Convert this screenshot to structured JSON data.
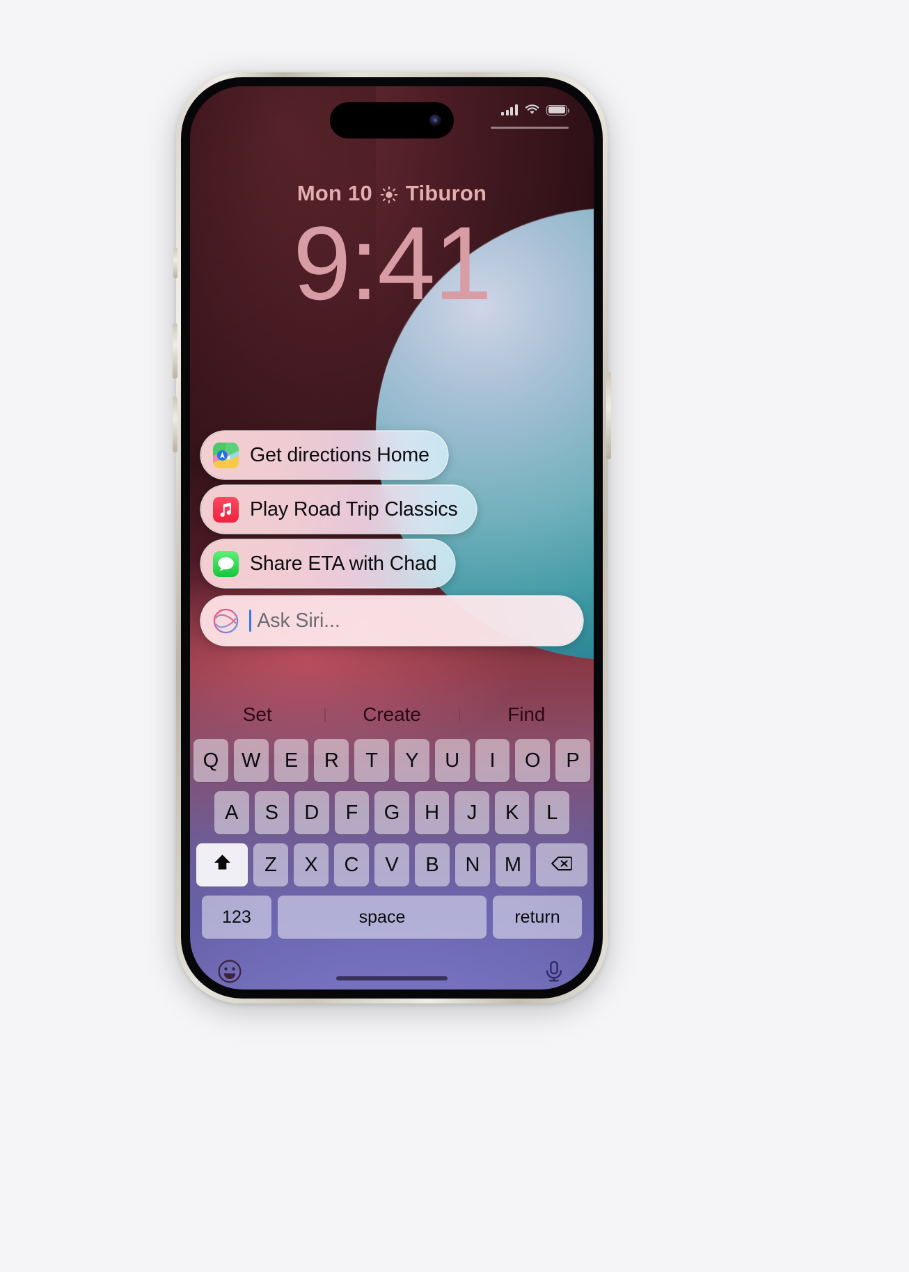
{
  "device": {
    "model": "iPhone",
    "frame_color": "#e8e4db"
  },
  "status_bar": {
    "signal_icon": "cellular-signal-icon",
    "signal_bars": 4,
    "wifi_icon": "wifi-icon",
    "battery_icon": "battery-icon",
    "battery_level": 100
  },
  "lock_screen": {
    "date": "Mon 10",
    "weather_icon": "sun-icon",
    "location": "Tiburon",
    "time": "9:41",
    "time_color": "#d79ca4",
    "date_color": "#e2aeb0"
  },
  "siri": {
    "orb_icon": "siri-orb-icon",
    "input_placeholder": "Ask Siri...",
    "input_value": "",
    "caret_color": "#2f7bf6",
    "suggestions": [
      {
        "label": "Get directions Home",
        "app": "maps",
        "icon": "maps-app-icon"
      },
      {
        "label": "Play Road Trip Classics",
        "app": "music",
        "icon": "music-app-icon"
      },
      {
        "label": "Share ETA with Chad",
        "app": "messages",
        "icon": "messages-app-icon"
      }
    ]
  },
  "predictive_bar": {
    "items": [
      "Set",
      "Create",
      "Find"
    ]
  },
  "keyboard": {
    "row1": [
      "Q",
      "W",
      "E",
      "R",
      "T",
      "Y",
      "U",
      "I",
      "O",
      "P"
    ],
    "row2": [
      "A",
      "S",
      "D",
      "F",
      "G",
      "H",
      "J",
      "K",
      "L"
    ],
    "row3": [
      "Z",
      "X",
      "C",
      "V",
      "B",
      "N",
      "M"
    ],
    "shift_icon": "shift-arrow-icon",
    "shift_active": true,
    "delete_icon": "delete-backspace-icon",
    "numbers_label": "123",
    "space_label": "space",
    "return_label": "return",
    "emoji_icon": "emoji-smiley-icon",
    "dictation_icon": "microphone-icon"
  }
}
